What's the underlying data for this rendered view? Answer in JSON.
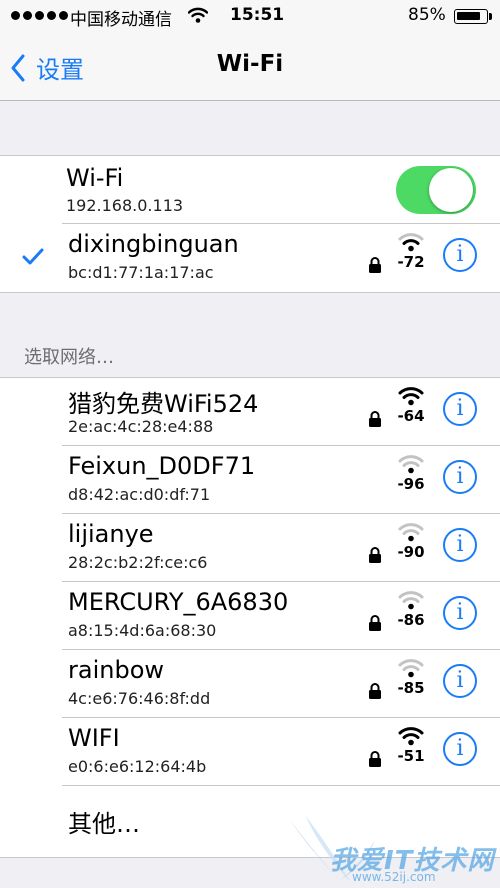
{
  "status_bar": {
    "carrier": "中国移动通信",
    "time": "15:51",
    "battery_percent_label": "85%",
    "battery_level": 0.85,
    "signal_dots": 5
  },
  "nav": {
    "back_label": "设置",
    "title": "Wi-Fi"
  },
  "wifi_toggle": {
    "label": "Wi-Fi",
    "ip": "192.168.0.113",
    "on": true
  },
  "connected": {
    "name": "dixingbinguan",
    "mac": "bc:d1:77:1a:17:ac",
    "rssi": "-72",
    "secured": true
  },
  "section_header": "选取网络…",
  "networks": [
    {
      "name": "猎豹免费WiFi524",
      "mac": "2e:ac:4c:28:e4:88",
      "rssi": "-64",
      "secured": true
    },
    {
      "name": "Feixun_D0DF71",
      "mac": "d8:42:ac:d0:df:71",
      "rssi": "-96",
      "secured": false
    },
    {
      "name": "lijianye",
      "mac": "28:2c:b2:2f:ce:c6",
      "rssi": "-90",
      "secured": true
    },
    {
      "name": "MERCURY_6A6830",
      "mac": "a8:15:4d:6a:68:30",
      "rssi": "-86",
      "secured": true
    },
    {
      "name": "rainbow",
      "mac": "4c:e6:76:46:8f:dd",
      "rssi": "-85",
      "secured": true
    },
    {
      "name": "WIFI",
      "mac": "e0:6:e6:12:64:4b",
      "rssi": "-51",
      "secured": true
    }
  ],
  "other_label": "其他…",
  "watermark": {
    "text": "我爱IT技术网",
    "url": "www.52ij.com"
  },
  "colors": {
    "accent": "#1a7cf5",
    "toggle_on": "#4cd964",
    "background": "#efeff4"
  }
}
